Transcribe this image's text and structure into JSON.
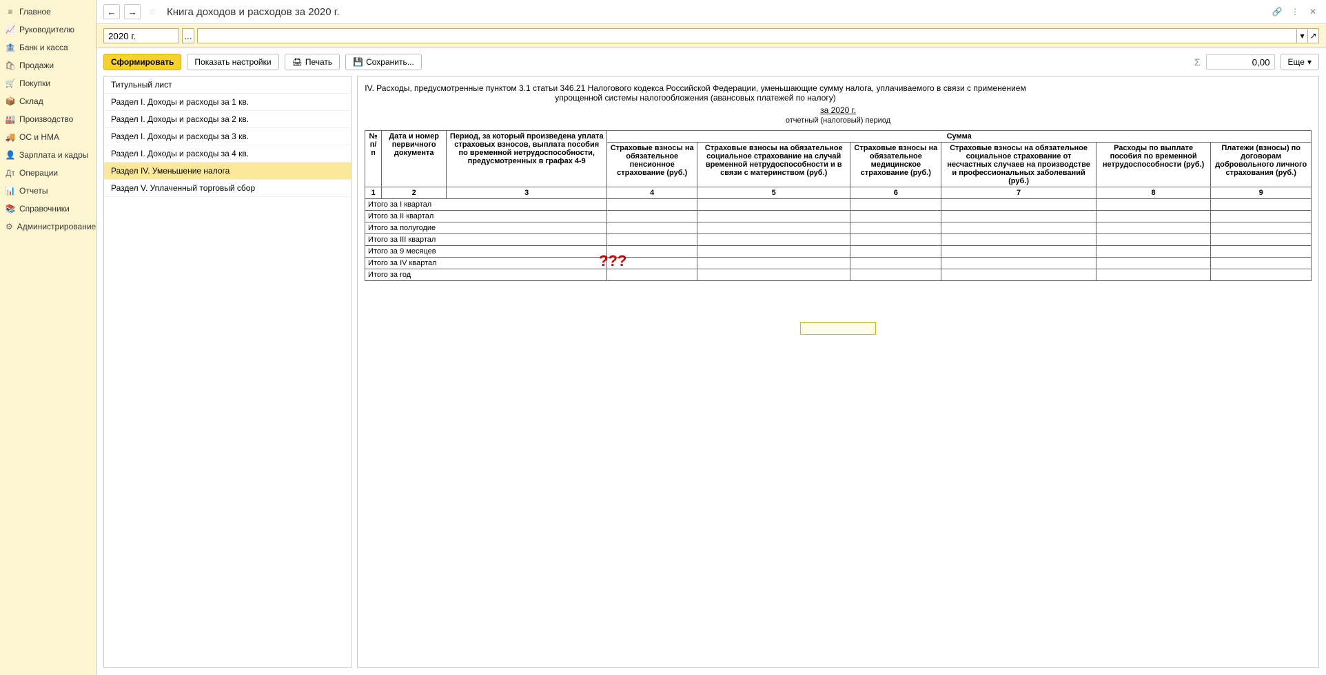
{
  "sidebar": {
    "items": [
      {
        "icon": "menu",
        "label": "Главное"
      },
      {
        "icon": "chart",
        "label": "Руководителю"
      },
      {
        "icon": "bank",
        "label": "Банк и касса"
      },
      {
        "icon": "bag",
        "label": "Продажи"
      },
      {
        "icon": "cart",
        "label": "Покупки"
      },
      {
        "icon": "box",
        "label": "Склад"
      },
      {
        "icon": "factory",
        "label": "Производство"
      },
      {
        "icon": "truck",
        "label": "ОС и НМА"
      },
      {
        "icon": "person",
        "label": "Зарплата и кадры"
      },
      {
        "icon": "ops",
        "label": "Операции"
      },
      {
        "icon": "bars",
        "label": "Отчеты"
      },
      {
        "icon": "book",
        "label": "Справочники"
      },
      {
        "icon": "gear",
        "label": "Администрирование"
      }
    ]
  },
  "header": {
    "title": "Книга доходов и расходов за 2020 г."
  },
  "periodbar": {
    "period": "2020 г.",
    "dots": "...",
    "dropdown": ""
  },
  "toolbar": {
    "form": "Сформировать",
    "settings": "Показать настройки",
    "print": "Печать",
    "save": "Сохранить...",
    "sum_value": "0,00",
    "more": "Еще"
  },
  "sections": {
    "items": [
      "Титульный лист",
      "Раздел I. Доходы и расходы за 1 кв.",
      "Раздел I. Доходы и расходы за 2 кв.",
      "Раздел I. Доходы и расходы за 3 кв.",
      "Раздел I. Доходы и расходы за 4 кв.",
      "Раздел IV. Уменьшение налога",
      "Раздел V. Уплаченный торговый сбор"
    ],
    "selected_index": 5
  },
  "report": {
    "title": "IV. Расходы, предусмотренные пунктом 3.1 статьи 346.21 Налогового кодекса Российской Федерации, уменьшающие сумму налога, уплачиваемого в связи с применением упрощенной системы налогообложения (авансовых платежей по налогу)",
    "year": "за 2020 г.",
    "subtitle": "отчетный (налоговый) период",
    "columns": {
      "num": "№ п/п",
      "date": "Дата и номер первичного документа",
      "period": "Период, за который произведена уплата страховых взносов, выплата пособия по временной нетрудоспособности, предусмотренных в графах 4-9",
      "sum_header": "Сумма",
      "c4": "Страховые взносы на обязательное пенсионное страхование (руб.)",
      "c5": "Страховые взносы на обязательное социальное страхование на случай временной нетрудоспособности и в связи с материнством (руб.)",
      "c6": "Страховые взносы на обязательное медицинское страхование (руб.)",
      "c7": "Страховые взносы на обязательное социальное страхование от несчастных случаев на производстве и профессиональных заболеваний (руб.)",
      "c8": "Расходы по выплате пособия по временной нетрудоспособности (руб.)",
      "c9": "Платежи (взносы) по договорам добровольного личного страхования (руб.)"
    },
    "col_nums": [
      "1",
      "2",
      "3",
      "4",
      "5",
      "6",
      "7",
      "8",
      "9"
    ],
    "rows": [
      "Итого за I квартал",
      "Итого за II квартал",
      "Итого за полугодие",
      "Итого за III квартал",
      "Итого за 9 месяцев",
      "Итого за IV квартал",
      "Итого за год"
    ],
    "annotation": "???"
  }
}
